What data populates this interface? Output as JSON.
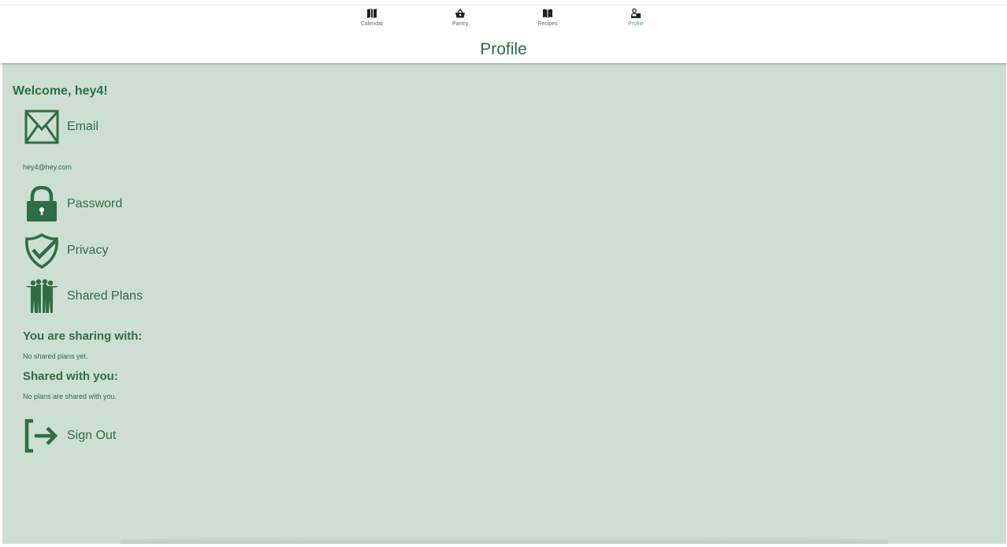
{
  "tabs": [
    {
      "label": "Calendar",
      "icon": "map-icon",
      "active": false
    },
    {
      "label": "Pantry",
      "icon": "basket-icon",
      "active": false
    },
    {
      "label": "Recipes",
      "icon": "book-icon",
      "active": false
    },
    {
      "label": "Profile",
      "icon": "user-card-icon",
      "active": true
    }
  ],
  "header": {
    "title": "Profile"
  },
  "profile": {
    "welcome": "Welcome, hey4!",
    "email_label": "Email",
    "email_value": "hey4@hey.com",
    "password_label": "Password",
    "privacy_label": "Privacy",
    "shared_plans_label": "Shared Plans",
    "sharing_with_title": "You are sharing with:",
    "sharing_with_empty": "No shared plans yet.",
    "shared_with_you_title": "Shared with you:",
    "shared_with_you_empty": "No plans are shared with you.",
    "sign_out_label": "Sign Out"
  },
  "colors": {
    "accent": "#2f6e44",
    "background": "#cddfd3",
    "active_tab": "#5aa775"
  }
}
